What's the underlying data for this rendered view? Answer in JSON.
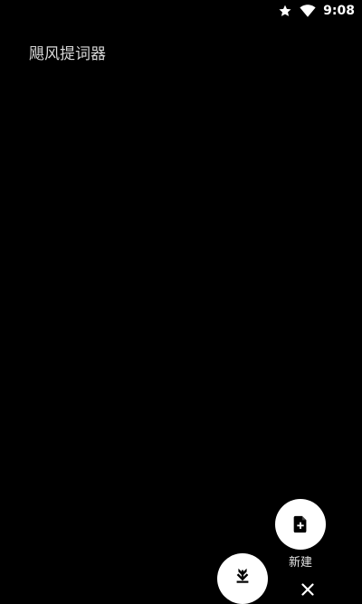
{
  "status_bar": {
    "time": "9:08",
    "icons": [
      "star-icon",
      "wifi-icon"
    ]
  },
  "app": {
    "title": "飓风提词器"
  },
  "fab_menu": {
    "new_label": "新建",
    "new_icon": "new-file-icon",
    "import_icon": "download-icon",
    "close_icon": "close-icon"
  },
  "colors": {
    "background": "#000000",
    "fab": "#ffffff",
    "fab_icon": "#000000",
    "title": "#d8d8d8"
  }
}
